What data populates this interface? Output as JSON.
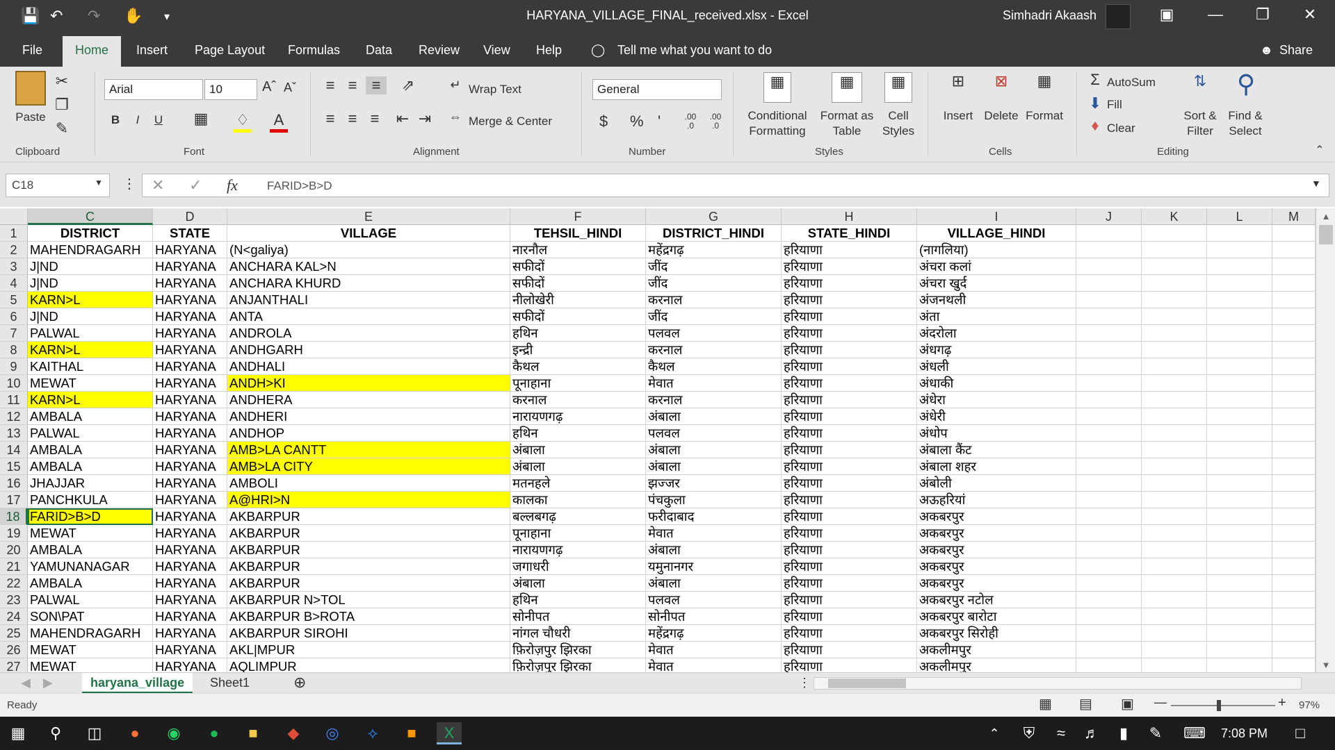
{
  "window": {
    "title": "HARYANA_VILLAGE_FINAL_received.xlsx  -  Excel",
    "user": "Simhadri Akaash"
  },
  "menu": {
    "tabs": [
      "File",
      "Home",
      "Insert",
      "Page Layout",
      "Formulas",
      "Data",
      "Review",
      "View",
      "Help"
    ],
    "active": "Home",
    "tell_me": "Tell me what you want to do",
    "share": "Share"
  },
  "ribbon": {
    "clipboard": {
      "label": "Clipboard",
      "paste": "Paste"
    },
    "font": {
      "label": "Font",
      "name": "Arial",
      "size": "10",
      "bold": "B",
      "italic": "I",
      "underline": "U"
    },
    "alignment": {
      "label": "Alignment",
      "wrap": "Wrap Text",
      "merge": "Merge & Center"
    },
    "number": {
      "label": "Number",
      "format": "General",
      "currency": "$",
      "percent": "%",
      "comma": "'",
      "inc_decimal": ".00 .0",
      "dec_decimal": ".00 .0"
    },
    "styles": {
      "label": "Styles",
      "conditional": "Conditional Formatting",
      "format_table": "Format as Table",
      "cell_styles": "Cell Styles"
    },
    "cells": {
      "label": "Cells",
      "insert": "Insert",
      "delete": "Delete",
      "format": "Format"
    },
    "editing": {
      "label": "Editing",
      "autosum": "AutoSum",
      "fill": "Fill",
      "clear": "Clear",
      "sort": "Sort & Filter",
      "find": "Find & Select"
    }
  },
  "formula_bar": {
    "name_box": "C18",
    "value": "FARID>B>D"
  },
  "columns": [
    "C",
    "D",
    "E",
    "F",
    "G",
    "H",
    "I",
    "J",
    "K",
    "L",
    "M"
  ],
  "selected_column": "C",
  "selected_row": 18,
  "table": {
    "header_row": 1,
    "headers": [
      "DISTRICT",
      "STATE",
      "VILLAGE",
      "TEHSIL_HINDI",
      "DISTRICT_HINDI",
      "STATE_HINDI",
      "VILLAGE_HINDI"
    ],
    "rows": [
      {
        "n": 2,
        "c": [
          "MAHENDRAGARH",
          "HARYANA",
          "(N<galiya)",
          "नारनौल",
          "महेंद्रगढ़",
          "हरियाणा",
          "(नागलिया)"
        ]
      },
      {
        "n": 3,
        "c": [
          "J|ND",
          "HARYANA",
          "ANCHARA KAL>N",
          "सफीदों",
          "जींद",
          "हरियाणा",
          "अंचरा कलां"
        ]
      },
      {
        "n": 4,
        "c": [
          "J|ND",
          "HARYANA",
          "ANCHARA KHURD",
          "सफीदों",
          "जींद",
          "हरियाणा",
          "अंचरा खुर्द"
        ]
      },
      {
        "n": 5,
        "c": [
          "KARN>L",
          "HARYANA",
          "ANJANTHALI",
          "नीलोखेरी",
          "करनाल",
          "हरियाणा",
          "अंजनथली"
        ],
        "hl": [
          0
        ]
      },
      {
        "n": 6,
        "c": [
          "J|ND",
          "HARYANA",
          "ANTA",
          "सफीदों",
          "जींद",
          "हरियाणा",
          "अंता"
        ]
      },
      {
        "n": 7,
        "c": [
          "PALWAL",
          "HARYANA",
          "ANDROLA",
          "हथिन",
          "पलवल",
          "हरियाणा",
          "अंदरोला"
        ]
      },
      {
        "n": 8,
        "c": [
          "KARN>L",
          "HARYANA",
          "ANDHGARH",
          "इन्द्री",
          "करनाल",
          "हरियाणा",
          "अंधगढ़"
        ],
        "hl": [
          0
        ]
      },
      {
        "n": 9,
        "c": [
          "KAITHAL",
          "HARYANA",
          "ANDHALI",
          "कैथल",
          "कैथल",
          "हरियाणा",
          "अंधली"
        ]
      },
      {
        "n": 10,
        "c": [
          "MEWAT",
          "HARYANA",
          "ANDH>KI",
          "पूनाहाना",
          "मेवात",
          "हरियाणा",
          "अंधाकी"
        ],
        "hl": [
          2
        ]
      },
      {
        "n": 11,
        "c": [
          "KARN>L",
          "HARYANA",
          "ANDHERA",
          "करनाल",
          "करनाल",
          "हरियाणा",
          "अंधेरा"
        ],
        "hl": [
          0
        ]
      },
      {
        "n": 12,
        "c": [
          "AMBALA",
          "HARYANA",
          "ANDHERI",
          "नारायणगढ़",
          "अंबाला",
          "हरियाणा",
          "अंधेरी"
        ]
      },
      {
        "n": 13,
        "c": [
          "PALWAL",
          "HARYANA",
          "ANDHOP",
          "हथिन",
          "पलवल",
          "हरियाणा",
          "अंधोप"
        ]
      },
      {
        "n": 14,
        "c": [
          "AMBALA",
          "HARYANA",
          "AMB>LA CANTT",
          "अंबाला",
          "अंबाला",
          "हरियाणा",
          "अंबाला कैंट"
        ],
        "hl": [
          2
        ]
      },
      {
        "n": 15,
        "c": [
          "AMBALA",
          "HARYANA",
          "AMB>LA CITY",
          "अंबाला",
          "अंबाला",
          "हरियाणा",
          "अंबाला शहर"
        ],
        "hl": [
          2
        ]
      },
      {
        "n": 16,
        "c": [
          "JHAJJAR",
          "HARYANA",
          "AMBOLI",
          "मतनहले",
          "झज्जर",
          "हरियाणा",
          "अंबोली"
        ]
      },
      {
        "n": 17,
        "c": [
          "PANCHKULA",
          "HARYANA",
          "A@HRI>N",
          "कालका",
          "पंचकुला",
          "हरियाणा",
          "अऊहरियां"
        ],
        "hl": [
          2
        ]
      },
      {
        "n": 18,
        "c": [
          "FARID>B>D",
          "HARYANA",
          "AKBARPUR",
          "बल्लबगढ़",
          "फरीदाबाद",
          "हरियाणा",
          "अकबरपुर"
        ],
        "hl": [
          0
        ]
      },
      {
        "n": 19,
        "c": [
          "MEWAT",
          "HARYANA",
          "AKBARPUR",
          "पूनाहाना",
          "मेवात",
          "हरियाणा",
          "अकबरपुर"
        ]
      },
      {
        "n": 20,
        "c": [
          "AMBALA",
          "HARYANA",
          "AKBARPUR",
          "नारायणगढ़",
          "अंबाला",
          "हरियाणा",
          "अकबरपुर"
        ]
      },
      {
        "n": 21,
        "c": [
          "YAMUNANAGAR",
          "HARYANA",
          "AKBARPUR",
          "जगाधरी",
          "यमुनानगर",
          "हरियाणा",
          "अकबरपुर"
        ]
      },
      {
        "n": 22,
        "c": [
          "AMBALA",
          "HARYANA",
          "AKBARPUR",
          "अंबाला",
          "अंबाला",
          "हरियाणा",
          "अकबरपुर"
        ]
      },
      {
        "n": 23,
        "c": [
          "PALWAL",
          "HARYANA",
          "AKBARPUR N>TOL",
          "हथिन",
          "पलवल",
          "हरियाणा",
          "अकबरपुर नटोल"
        ]
      },
      {
        "n": 24,
        "c": [
          "SON\\PAT",
          "HARYANA",
          "AKBARPUR B>ROTA",
          "सोनीपत",
          "सोनीपत",
          "हरियाणा",
          "अकबरपुर बारोटा"
        ]
      },
      {
        "n": 25,
        "c": [
          "MAHENDRAGARH",
          "HARYANA",
          "AKBARPUR SIROHI",
          "नांगल चौधरी",
          "महेंद्रगढ़",
          "हरियाणा",
          "अकबरपुर सिरोही"
        ]
      },
      {
        "n": 26,
        "c": [
          "MEWAT",
          "HARYANA",
          "AKL|MPUR",
          "फ़िरोज़पुर झिरका",
          "मेवात",
          "हरियाणा",
          "अकलीमपुर"
        ]
      },
      {
        "n": 27,
        "c": [
          "MEWAT",
          "HARYANA",
          "AQLIMPUR",
          "फ़िरोज़पुर झिरका",
          "मेवात",
          "हरियाणा",
          "अकलीमपुर"
        ]
      }
    ]
  },
  "sheets": [
    "haryana_village",
    "Sheet1"
  ],
  "active_sheet": "haryana_village",
  "status": {
    "ready": "Ready",
    "zoom": "97%"
  },
  "taskbar": {
    "time": "7:08 PM"
  },
  "colors": {
    "accent": "#217346",
    "highlight": "#ffff00",
    "chrome": "#3a3a3a"
  }
}
